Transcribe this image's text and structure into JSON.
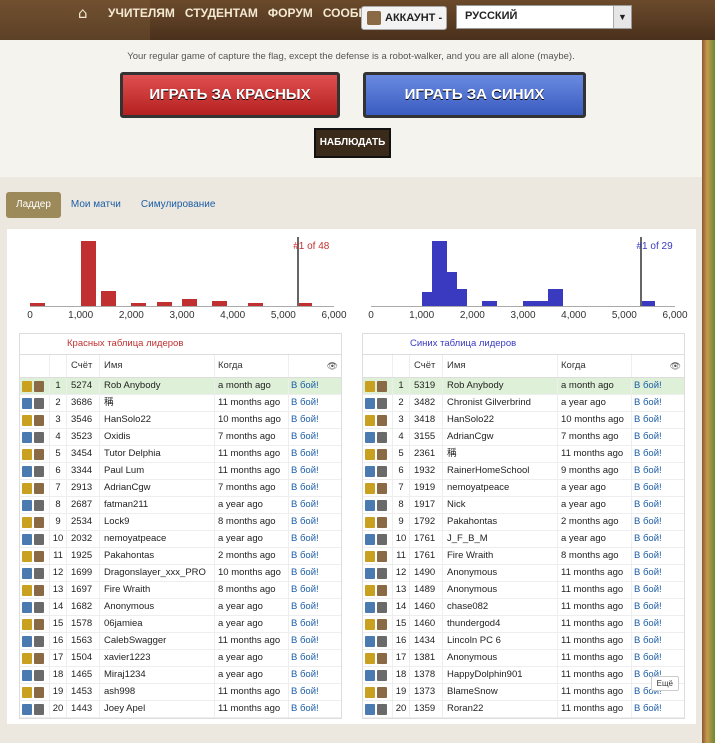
{
  "nav": {
    "items": [
      "УЧИТЕЛЯМ",
      "СТУДЕНТАМ",
      "ФОРУМ",
      "СООБЩЕСТВО"
    ],
    "account": "АККАУНТ -",
    "language": "РУССКИЙ"
  },
  "level": {
    "description": "Your regular game of capture the flag, except the defense is a robot-walker, and you are all alone (maybe).",
    "play_red": "ИГРАТЬ ЗА КРАСНЫХ",
    "play_blue": "ИГРАТЬ ЗА СИНИХ",
    "spectate": "НАБЛЮДАТЬ"
  },
  "tabs": [
    "Ладдер",
    "Мои матчи",
    "Симулирование"
  ],
  "colors": {
    "red": "#c03030",
    "blue": "#3a3ac0",
    "green_row": "#dff0d8",
    "link": "#1c5ea6"
  },
  "histogram_ticks": [
    "0",
    "1,000",
    "2,000",
    "3,000",
    "4,000",
    "5,000",
    "6,000"
  ],
  "red": {
    "rank_label": "#1 of 48",
    "title": "Красных таблица лидеров",
    "histogram": [
      {
        "score": 0,
        "height": 0.04
      },
      {
        "score": 1000,
        "height": 0.95
      },
      {
        "score": 1400,
        "height": 0.22
      },
      {
        "score": 2000,
        "height": 0.05
      },
      {
        "score": 2500,
        "height": 0.06
      },
      {
        "score": 3000,
        "height": 0.1
      },
      {
        "score": 3600,
        "height": 0.08
      },
      {
        "score": 4300,
        "height": 0.04
      },
      {
        "score": 5274,
        "height": 0.04
      }
    ],
    "you_score": 5274
  },
  "blue": {
    "rank_label": "#1 of 29",
    "title": "Синих таблица лидеров",
    "histogram": [
      {
        "score": 1000,
        "height": 0.2
      },
      {
        "score": 1200,
        "height": 0.95
      },
      {
        "score": 1400,
        "height": 0.5
      },
      {
        "score": 1600,
        "height": 0.25
      },
      {
        "score": 2200,
        "height": 0.08
      },
      {
        "score": 3000,
        "height": 0.08
      },
      {
        "score": 3300,
        "height": 0.08
      },
      {
        "score": 3500,
        "height": 0.25
      },
      {
        "score": 5319,
        "height": 0.08
      }
    ],
    "you_score": 5319
  },
  "table_headers": {
    "score": "Счёт",
    "name": "Имя",
    "when": "Когда"
  },
  "fight_label": "В бой!",
  "more_label": "Ещё",
  "red_rows": [
    {
      "rank": "1",
      "score": "5274",
      "name": "Rob Anybody",
      "when": "a month ago"
    },
    {
      "rank": "2",
      "score": "3686",
      "name": "稱",
      "when": "11 months ago"
    },
    {
      "rank": "3",
      "score": "3546",
      "name": "HanSolo22",
      "when": "10 months ago"
    },
    {
      "rank": "4",
      "score": "3523",
      "name": "Oxidis",
      "when": "7 months ago"
    },
    {
      "rank": "5",
      "score": "3454",
      "name": "Tutor Delphia",
      "when": "11 months ago"
    },
    {
      "rank": "6",
      "score": "3344",
      "name": "Paul Lum",
      "when": "11 months ago"
    },
    {
      "rank": "7",
      "score": "2913",
      "name": "AdrianCgw",
      "when": "7 months ago"
    },
    {
      "rank": "8",
      "score": "2687",
      "name": "fatman211",
      "when": "a year ago"
    },
    {
      "rank": "9",
      "score": "2534",
      "name": "Lock9",
      "when": "8 months ago"
    },
    {
      "rank": "10",
      "score": "2032",
      "name": "nemoyatpeace",
      "when": "a year ago"
    },
    {
      "rank": "11",
      "score": "1925",
      "name": "Pakahontas",
      "when": "2 months ago"
    },
    {
      "rank": "12",
      "score": "1699",
      "name": "Dragonslayer_xxx_PRO",
      "when": "10 months ago"
    },
    {
      "rank": "13",
      "score": "1697",
      "name": "Fire Wraith",
      "when": "8 months ago"
    },
    {
      "rank": "14",
      "score": "1682",
      "name": "Anonymous",
      "when": "a year ago"
    },
    {
      "rank": "15",
      "score": "1578",
      "name": "06jamiea",
      "when": "a year ago"
    },
    {
      "rank": "16",
      "score": "1563",
      "name": "CalebSwagger",
      "when": "11 months ago"
    },
    {
      "rank": "17",
      "score": "1504",
      "name": "xavier1223",
      "when": "a year ago"
    },
    {
      "rank": "18",
      "score": "1465",
      "name": "Miraj1234",
      "when": "a year ago"
    },
    {
      "rank": "19",
      "score": "1453",
      "name": "ash998",
      "when": "11 months ago"
    },
    {
      "rank": "20",
      "score": "1443",
      "name": "Joey Apel",
      "when": "11 months ago"
    }
  ],
  "blue_rows": [
    {
      "rank": "1",
      "score": "5319",
      "name": "Rob Anybody",
      "when": "a month ago"
    },
    {
      "rank": "2",
      "score": "3482",
      "name": "Chronist Gilverbrind",
      "when": "a year ago"
    },
    {
      "rank": "3",
      "score": "3418",
      "name": "HanSolo22",
      "when": "10 months ago"
    },
    {
      "rank": "4",
      "score": "3155",
      "name": "AdrianCgw",
      "when": "7 months ago"
    },
    {
      "rank": "5",
      "score": "2361",
      "name": "稱",
      "when": "11 months ago"
    },
    {
      "rank": "6",
      "score": "1932",
      "name": "RainerHomeSchool",
      "when": "9 months ago"
    },
    {
      "rank": "7",
      "score": "1919",
      "name": "nemoyatpeace",
      "when": "a year ago"
    },
    {
      "rank": "8",
      "score": "1917",
      "name": "Nick",
      "when": "a year ago"
    },
    {
      "rank": "9",
      "score": "1792",
      "name": "Pakahontas",
      "when": "2 months ago"
    },
    {
      "rank": "10",
      "score": "1761",
      "name": "J_F_B_M",
      "when": "a year ago"
    },
    {
      "rank": "11",
      "score": "1761",
      "name": "Fire Wraith",
      "when": "8 months ago"
    },
    {
      "rank": "12",
      "score": "1490",
      "name": "Anonymous",
      "when": "11 months ago"
    },
    {
      "rank": "13",
      "score": "1489",
      "name": "Anonymous",
      "when": "11 months ago"
    },
    {
      "rank": "14",
      "score": "1460",
      "name": "chase082",
      "when": "11 months ago"
    },
    {
      "rank": "15",
      "score": "1460",
      "name": "thundergod4",
      "when": "11 months ago"
    },
    {
      "rank": "16",
      "score": "1434",
      "name": "Lincoln PC 6",
      "when": "11 months ago"
    },
    {
      "rank": "17",
      "score": "1381",
      "name": "Anonymous",
      "when": "11 months ago"
    },
    {
      "rank": "18",
      "score": "1378",
      "name": "HappyDolphin901",
      "when": "11 months ago"
    },
    {
      "rank": "19",
      "score": "1373",
      "name": "BlameSnow",
      "when": "11 months ago"
    },
    {
      "rank": "20",
      "score": "1359",
      "name": "Roran22",
      "when": "11 months ago"
    }
  ]
}
